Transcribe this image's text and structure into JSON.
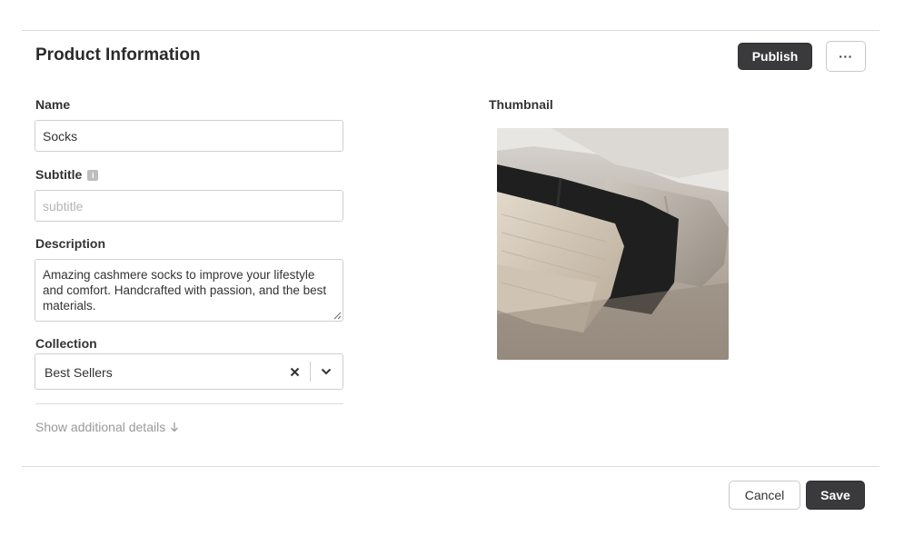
{
  "header": {
    "title": "Product Information",
    "publish_label": "Publish",
    "more_label": "···"
  },
  "form": {
    "name": {
      "label": "Name",
      "value": "Socks"
    },
    "subtitle": {
      "label": "Subtitle",
      "info_icon": "i",
      "placeholder": "subtitle",
      "value": ""
    },
    "description": {
      "label": "Description",
      "value": "Amazing cashmere socks to improve your lifestyle and comfort. Handcrafted with passion, and the best materials."
    },
    "collection": {
      "label": "Collection",
      "value": "Best Sellers"
    },
    "show_details_label": "Show additional details",
    "show_details_icon": "arrow-down-icon"
  },
  "thumbnail": {
    "label": "Thumbnail",
    "image": "folded-socks-photo"
  },
  "footer": {
    "cancel_label": "Cancel",
    "save_label": "Save"
  },
  "colors": {
    "primary_button": "#3a3a3c",
    "border": "#cfcfcf",
    "muted_text": "#9a9a9a"
  }
}
